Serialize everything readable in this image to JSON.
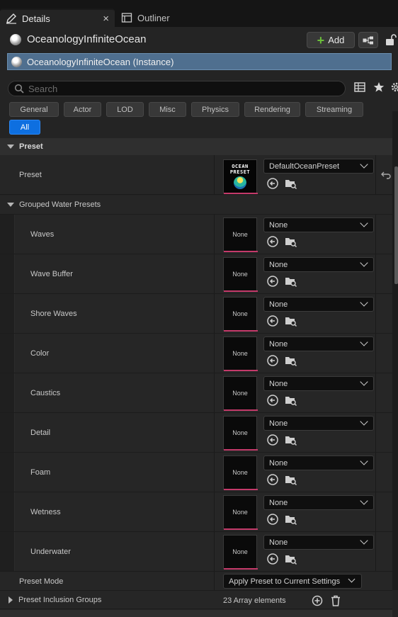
{
  "tabs": {
    "details_label": "Details",
    "close_glyph": "×",
    "outliner_label": "Outliner"
  },
  "header": {
    "actor_name": "OceanologyInfiniteOcean",
    "add_label": "Add",
    "instance_label": "OceanologyInfiniteOcean (Instance)"
  },
  "search": {
    "placeholder": "Search"
  },
  "filters": [
    "General",
    "Actor",
    "LOD",
    "Misc",
    "Physics",
    "Rendering",
    "Streaming",
    "All"
  ],
  "active_filter": "All",
  "category": {
    "title": "Preset"
  },
  "preset_row": {
    "label": "Preset",
    "value": "DefaultOceanPreset",
    "thumb_text_line1": "OCEAN",
    "thumb_text_line2": "PRESET"
  },
  "grouped": {
    "title": "Grouped Water Presets",
    "none_thumb": "None",
    "items": [
      {
        "label": "Waves",
        "value": "None"
      },
      {
        "label": "Wave Buffer",
        "value": "None"
      },
      {
        "label": "Shore Waves",
        "value": "None"
      },
      {
        "label": "Color",
        "value": "None"
      },
      {
        "label": "Caustics",
        "value": "None"
      },
      {
        "label": "Detail",
        "value": "None"
      },
      {
        "label": "Foam",
        "value": "None"
      },
      {
        "label": "Wetness",
        "value": "None"
      },
      {
        "label": "Underwater",
        "value": "None"
      }
    ]
  },
  "preset_mode": {
    "label": "Preset Mode",
    "value": "Apply Preset to Current Settings"
  },
  "inclusion": {
    "label": "Preset Inclusion Groups",
    "value": "23 Array elements"
  },
  "colors": {
    "accent": "#0e6fe0",
    "selection": "#4f6f8f",
    "thumb_underline": "#c43a6a",
    "add_plus": "#6bbf3a"
  }
}
